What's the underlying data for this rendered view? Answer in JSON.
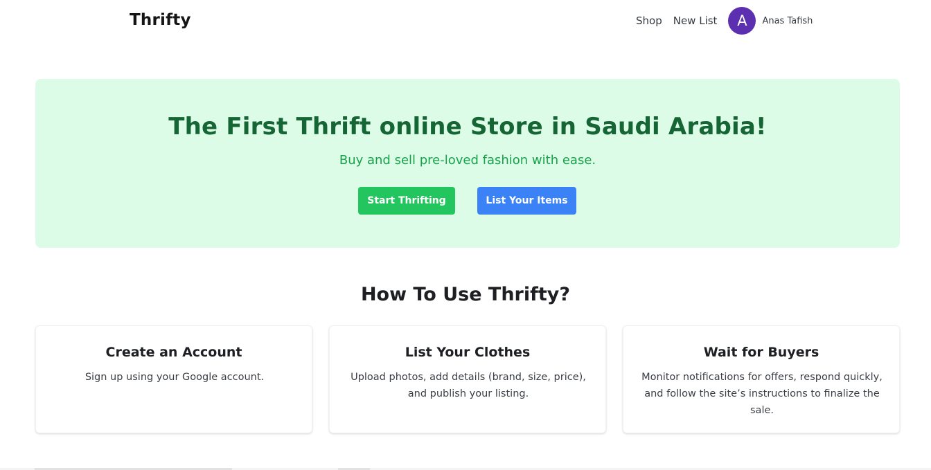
{
  "nav": {
    "brand": "Thrifty",
    "links": [
      "Shop",
      "New List"
    ],
    "user": {
      "initial": "A",
      "name": "Anas Tafish"
    }
  },
  "hero": {
    "title": "The First Thrift online Store in Saudi Arabia!",
    "subtitle": "Buy and sell pre-loved fashion with ease.",
    "primary_button": "Start Thrifting",
    "secondary_button": "List Your Items"
  },
  "how_to": {
    "title": "How To Use Thrifty?",
    "cards": [
      {
        "title": "Create an Account",
        "text": "Sign up using your Google account."
      },
      {
        "title": "List Your Clothes",
        "text": "Upload photos, add details (brand, size, price), and publish your listing."
      },
      {
        "title": "Wait for Buyers",
        "text": "Monitor notifications for offers, respond quickly, and follow the site’s instructions to finalize the sale."
      }
    ]
  },
  "colors": {
    "hero_bg": "#dcfce7",
    "hero_title": "#166534",
    "hero_subtitle": "#16a34a",
    "primary_button": "#22c55e",
    "secondary_button": "#3b82f6",
    "avatar": "#5b2fb0"
  }
}
